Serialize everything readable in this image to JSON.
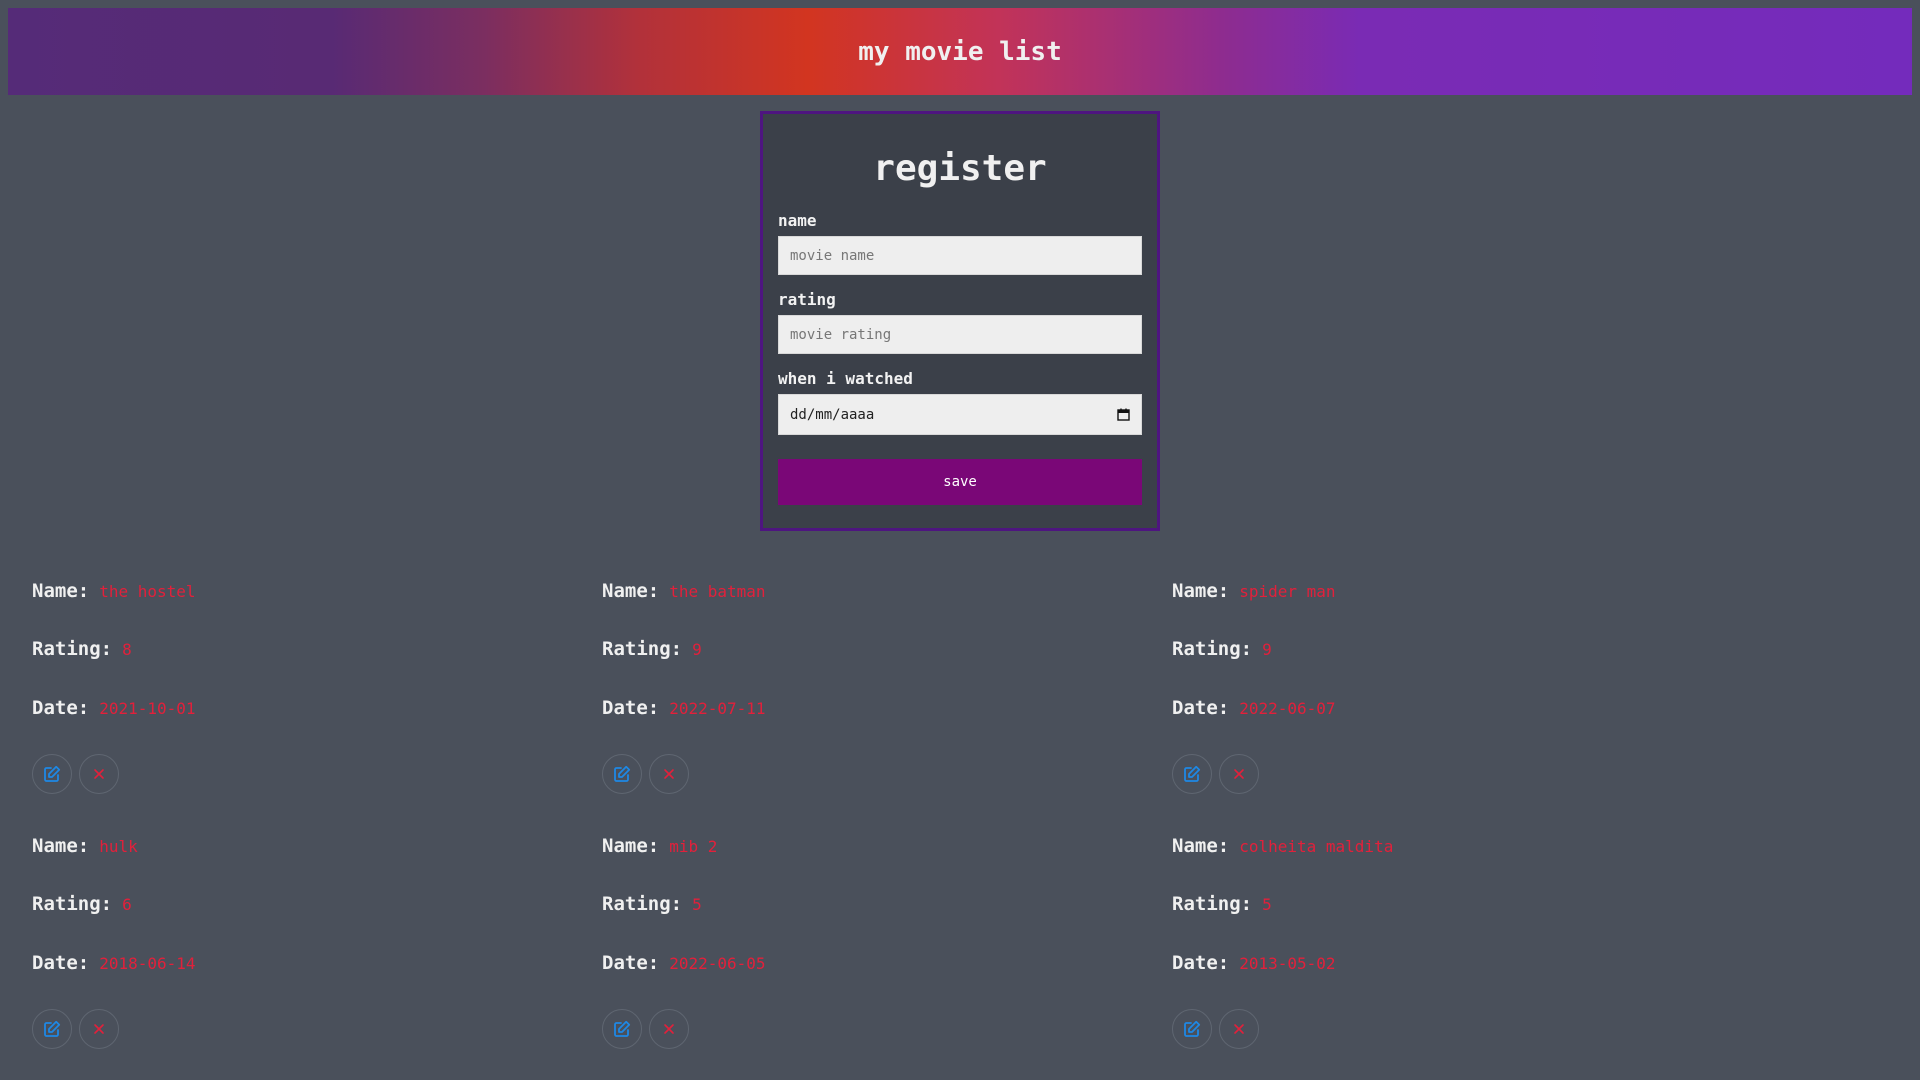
{
  "header": {
    "title": "my movie list"
  },
  "form": {
    "title": "register",
    "name_label": "name",
    "name_placeholder": "movie name",
    "rating_label": "rating",
    "rating_placeholder": "movie rating",
    "date_label": "when i watched",
    "date_placeholder": "dd/mm/aaaa",
    "save_label": "save"
  },
  "labels": {
    "name": "Name:",
    "rating": "Rating:",
    "date": "Date:"
  },
  "colors": {
    "value_text": "#e2203b",
    "edit_icon": "#1e88e5",
    "delete_icon": "#e2203b",
    "save_button": "#7a0777"
  },
  "movies": [
    {
      "name": "the hostel",
      "rating": "8",
      "date": "2021-10-01"
    },
    {
      "name": "the batman",
      "rating": "9",
      "date": "2022-07-11"
    },
    {
      "name": "spider man",
      "rating": "9",
      "date": "2022-06-07"
    },
    {
      "name": "hulk",
      "rating": "6",
      "date": "2018-06-14"
    },
    {
      "name": "mib 2",
      "rating": "5",
      "date": "2022-06-05"
    },
    {
      "name": "colheita maldita",
      "rating": "5",
      "date": "2013-05-02"
    }
  ]
}
